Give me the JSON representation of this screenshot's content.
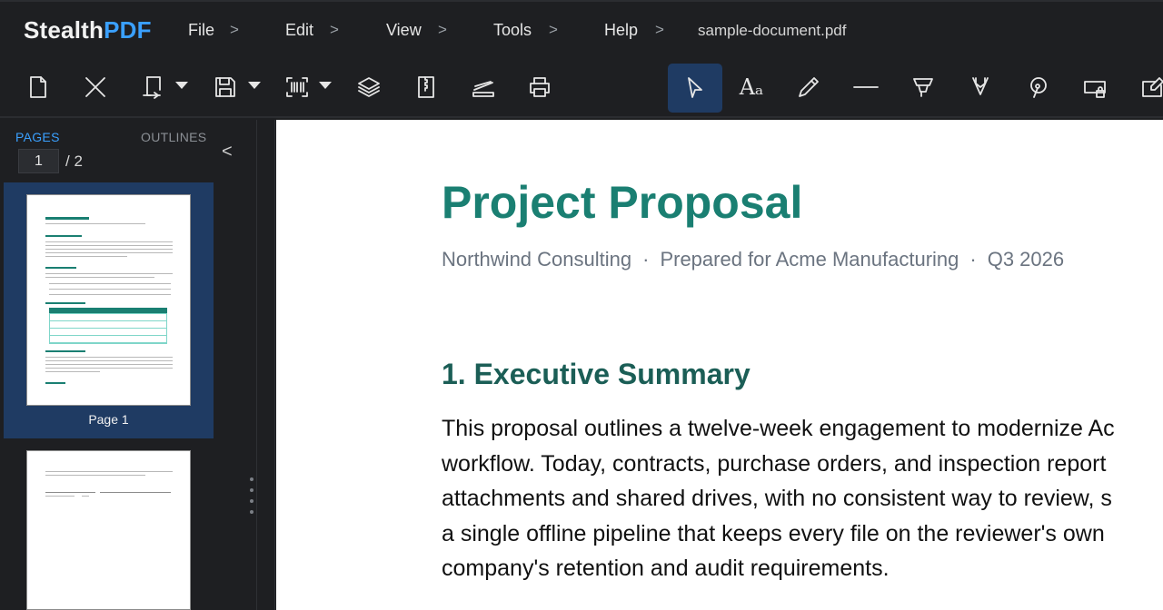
{
  "app": {
    "name_part1": "Stealth",
    "name_part2": "PDF",
    "brand_color": "#3aa0ff"
  },
  "menu": {
    "items": [
      {
        "label": "File"
      },
      {
        "label": "Edit"
      },
      {
        "label": "View"
      },
      {
        "label": "Tools"
      },
      {
        "label": "Help"
      }
    ],
    "chevron": ">",
    "filename": "sample-document.pdf"
  },
  "toolbar": {
    "left_tools": [
      "new-document-icon",
      "close-icon",
      "export-icon",
      "save-icon",
      "scan-icon",
      "layers-icon",
      "compress-icon",
      "scanner-icon",
      "print-icon"
    ],
    "right_tools": [
      "select-cursor-icon",
      "text-icon",
      "pencil-icon",
      "line-icon",
      "highlighter-icon",
      "marker-icon",
      "lasso-icon",
      "redact-icon",
      "edit-icon"
    ],
    "text_tool_label": "Aₐ",
    "active_tool": "select-cursor-icon",
    "active_color": "#1f3b63"
  },
  "sidebar": {
    "tabs": [
      {
        "label": "PAGES",
        "active": true
      },
      {
        "label": "OUTLINES",
        "active": false
      }
    ],
    "collapse_glyph": "<",
    "current_page": "1",
    "total_pages": "/ 2",
    "thumbnails": [
      {
        "label": "Page 1",
        "selected": true
      },
      {
        "label": "",
        "selected": false
      }
    ]
  },
  "document": {
    "title": "Project Proposal",
    "subtitle": {
      "company": "Northwind Consulting",
      "separator": "·",
      "prepared_for": "Prepared for Acme Manufacturing",
      "quarter": "Q3 2026"
    },
    "section_heading": "1. Executive Summary",
    "paragraph_lines": [
      "This proposal outlines a twelve-week engagement to modernize Ac",
      "workflow. Today, contracts, purchase orders, and inspection report",
      "attachments and shared drives, with no consistent way to review, s",
      "a single offline pipeline that keeps every file on the reviewer's own",
      "company's retention and audit requirements."
    ],
    "title_color": "#1a7f72",
    "heading_color": "#1b5e56"
  }
}
